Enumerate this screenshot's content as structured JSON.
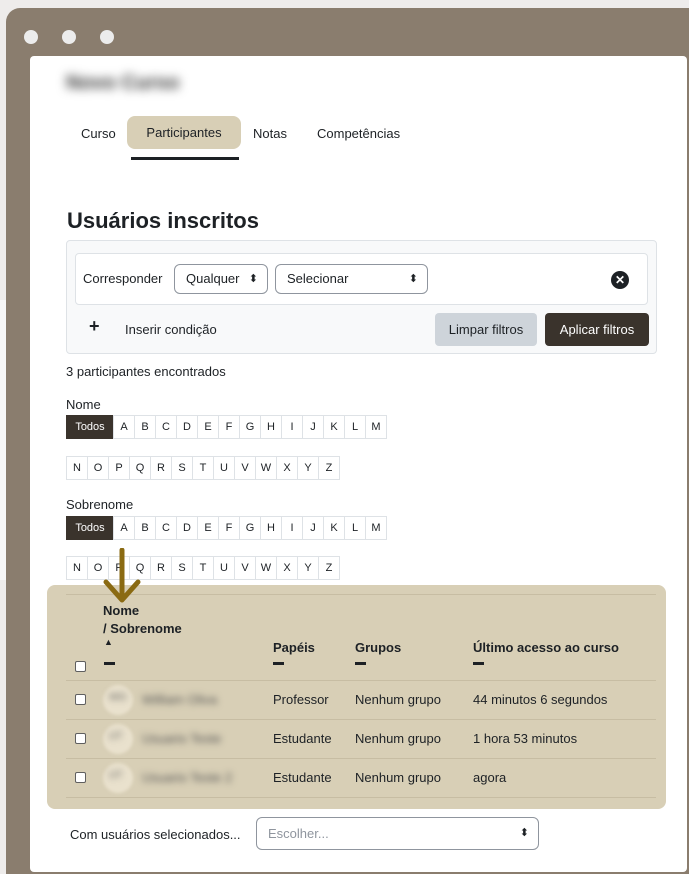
{
  "course_title": "Novo Curso",
  "tabs": [
    "Curso",
    "Participantes",
    "Notas",
    "Competências"
  ],
  "active_tab": "Participantes",
  "heading": "Usuários inscritos",
  "filters": {
    "match_label": "Corresponder",
    "match_value": "Qualquer",
    "condition_value": "Selecionar",
    "add_condition": "Inserir condição",
    "clear_button": "Limpar filtros",
    "apply_button": "Aplicar filtros"
  },
  "participants_found": "3 participantes encontrados",
  "initials": {
    "first_label": "Nome",
    "last_label": "Sobrenome",
    "all": "Todos",
    "row1": [
      "A",
      "B",
      "C",
      "D",
      "E",
      "F",
      "G",
      "H",
      "I",
      "J",
      "K",
      "L",
      "M"
    ],
    "row2": [
      "N",
      "O",
      "P",
      "Q",
      "R",
      "S",
      "T",
      "U",
      "V",
      "W",
      "X",
      "Y",
      "Z"
    ]
  },
  "table": {
    "headers": {
      "name_line1": "Nome",
      "name_line2": "/ Sobrenome",
      "sort_glyph": "▲",
      "roles": "Papéis",
      "groups": "Grupos",
      "last_access": "Último acesso ao curso"
    },
    "rows": [
      {
        "initials": "WO",
        "name": "William Oliva",
        "role": "Professor",
        "group": "Nenhum grupo",
        "access": "44 minutos 6 segundos"
      },
      {
        "initials": "UT",
        "name": "Usuario Teste",
        "role": "Estudante",
        "group": "Nenhum grupo",
        "access": "1 hora 53 minutos"
      },
      {
        "initials": "UT",
        "name": "Usuario Teste 2",
        "role": "Estudante",
        "group": "Nenhum grupo",
        "access": "agora"
      }
    ]
  },
  "bulk": {
    "label": "Com usuários selecionados...",
    "placeholder": "Escolher..."
  },
  "colors": {
    "accent": "#d8cfb6",
    "frame": "#8a7d6e",
    "dark_button": "#3a332c",
    "arrow": "#8a6a12"
  },
  "icons": {
    "caret": "updown-caret-icon",
    "close": "close-circle-icon",
    "plus": "plus-icon",
    "arrow": "down-arrow-annotation-icon"
  }
}
